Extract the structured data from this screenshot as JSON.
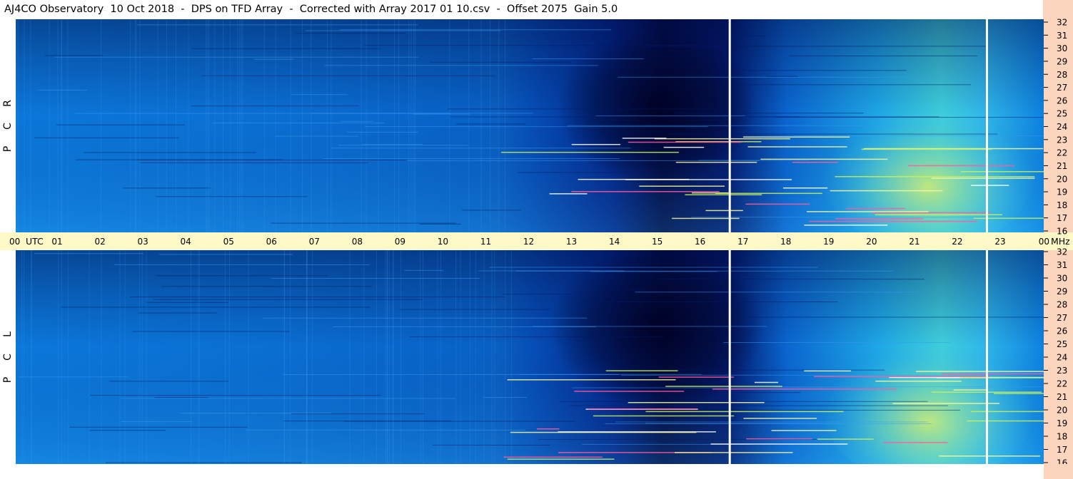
{
  "header": {
    "title": "AJ4CO Observatory  10 Oct 2018  -  DPS on TFD Array  -  Corrected with Array 2017 01 10.csv  -  Offset 2075  Gain 5.0"
  },
  "panels": {
    "rcp": {
      "letters": [
        "R",
        "C",
        "P"
      ]
    },
    "lcp": {
      "letters": [
        "L",
        "C",
        "P"
      ]
    }
  },
  "colors": {
    "background": "#ffffff",
    "utc_strip": "#fff9c8",
    "freq_axis": "#fbd5bd",
    "low_intensity": "#001060",
    "mid_intensity": "#0a74dc",
    "high_intensity": "#e8f060",
    "marker_line": "#ffffff"
  },
  "chart_data": {
    "type": "heatmap",
    "title": "AJ4CO Observatory  10 Oct 2018  -  DPS on TFD Array  -  Corrected with Array 2017 01 10.csv  -  Offset 2075  Gain 5.0",
    "x_axis": {
      "unit_label": "UTC",
      "range_hours": [
        0,
        24
      ],
      "tick_labels": [
        "00",
        "01",
        "02",
        "03",
        "04",
        "05",
        "06",
        "07",
        "08",
        "09",
        "10",
        "11",
        "12",
        "13",
        "14",
        "15",
        "16",
        "17",
        "18",
        "19",
        "20",
        "21",
        "22",
        "23",
        "00"
      ]
    },
    "y_axis": {
      "unit_label": "MHz",
      "range_mhz": [
        16,
        32
      ],
      "tick_labels": [
        "32",
        "31",
        "30",
        "29",
        "28",
        "27",
        "26",
        "25",
        "24",
        "23",
        "22",
        "21",
        "20",
        "19",
        "18",
        "17",
        "16"
      ]
    },
    "series": [
      {
        "name": "RCP"
      },
      {
        "name": "LCP"
      }
    ],
    "marker_lines_utc": [
      16.7,
      22.7
    ]
  }
}
